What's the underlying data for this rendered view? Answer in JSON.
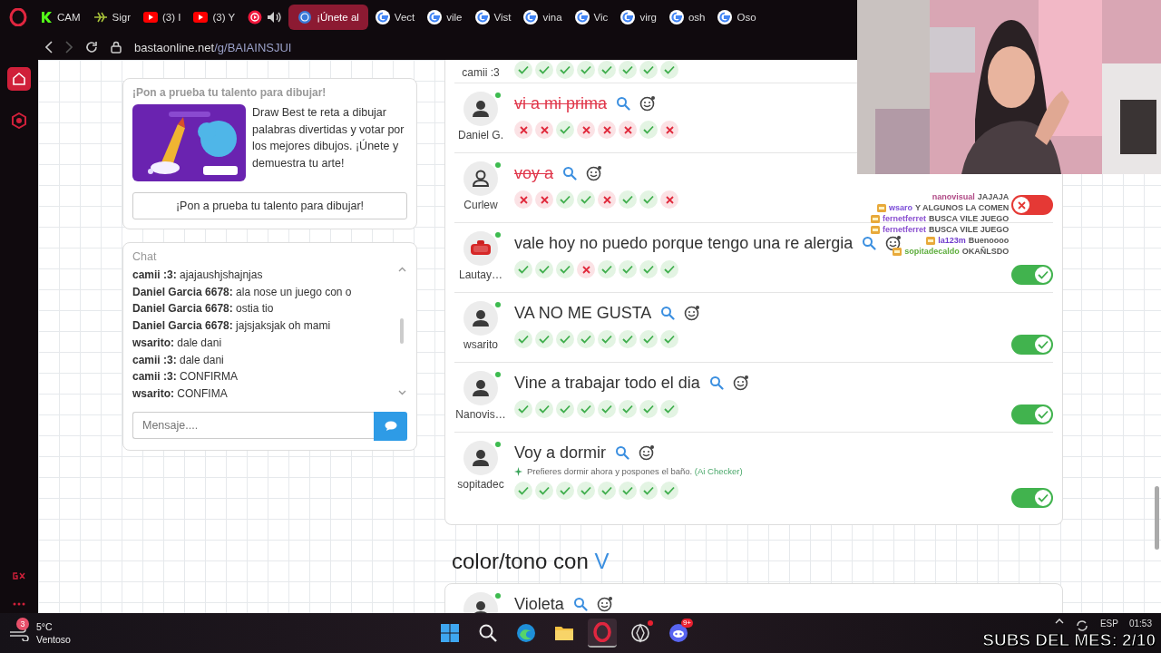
{
  "browser": {
    "tabs": [
      {
        "kind": "k",
        "label": "CAM",
        "selected": false,
        "audio": false
      },
      {
        "kind": "leaf",
        "label": "Sigr",
        "selected": false,
        "audio": false
      },
      {
        "kind": "youtube",
        "label": "(3) I",
        "selected": false,
        "audio": false
      },
      {
        "kind": "youtube",
        "label": "(3) Y",
        "selected": false,
        "audio": false
      },
      {
        "kind": "music",
        "selected": false,
        "audio": true
      },
      {
        "kind": "basta",
        "label": "¡Únete al",
        "selected": true,
        "audio": false
      },
      {
        "kind": "google",
        "label": "Vect",
        "selected": false,
        "audio": false
      },
      {
        "kind": "google",
        "label": "vile",
        "selected": false,
        "audio": false
      },
      {
        "kind": "google",
        "label": "Vist",
        "selected": false,
        "audio": false
      },
      {
        "kind": "google",
        "label": "vina",
        "selected": false,
        "audio": false
      },
      {
        "kind": "google",
        "label": "Vic",
        "selected": false,
        "audio": false
      },
      {
        "kind": "google",
        "label": "virg",
        "selected": false,
        "audio": false
      },
      {
        "kind": "google",
        "label": "osh",
        "selected": false,
        "audio": false
      },
      {
        "kind": "google",
        "label": "Oso",
        "selected": false,
        "audio": false
      }
    ],
    "url_host": "bastaonline.net",
    "url_path": "/g/BAIAINSJUI"
  },
  "promo": {
    "heading": "¡Pon a prueba tu talento para dibujar!",
    "description": "Draw Best te reta a dibujar palabras divertidas y votar por los mejores dibujos. ¡Únete y demuestra tu arte!",
    "button": "¡Pon a prueba tu talento para dibujar!"
  },
  "chat": {
    "title": "Chat",
    "placeholder": "Mensaje....",
    "messages": [
      {
        "user": "camii :3:",
        "text": "ajajaushjshajnjas"
      },
      {
        "user": "Daniel Garcia 6678:",
        "text": "ala nose un juego con o"
      },
      {
        "user": "Daniel Garcia 6678:",
        "text": "ostia tio"
      },
      {
        "user": "Daniel Garcia 6678:",
        "text": "jajsjaksjak oh mami"
      },
      {
        "user": "wsarito:",
        "text": "dale dani"
      },
      {
        "user": "camii :3:",
        "text": "dale dani"
      },
      {
        "user": "camii :3:",
        "text": "CONFIRMA"
      },
      {
        "user": "wsarito:",
        "text": "CONFIMA"
      }
    ]
  },
  "answers": [
    {
      "user": "camii :3",
      "votes": [
        true,
        true,
        true,
        true,
        true,
        true,
        true,
        true
      ]
    },
    {
      "user": "Daniel G.",
      "kind": "person",
      "online": true,
      "answer": "vi a mi prima",
      "rejected": true,
      "votes": [
        false,
        false,
        true,
        false,
        false,
        false,
        true,
        false
      ]
    },
    {
      "user": "Curlew",
      "kind": "person-outline",
      "online": true,
      "answer": "voy a",
      "rejected": true,
      "votes": [
        false,
        false,
        true,
        true,
        false,
        true,
        true,
        false
      ],
      "valid": false
    },
    {
      "user": "Lautay…",
      "kind": "stop",
      "online": true,
      "answer": "vale hoy no puedo porque tengo una re alergia",
      "rejected": false,
      "votes": [
        true,
        true,
        true,
        false,
        true,
        true,
        true,
        true
      ],
      "valid": true
    },
    {
      "user": "wsarito",
      "kind": "person",
      "online": true,
      "answer": "VA NO ME GUSTA",
      "rejected": false,
      "votes": [
        true,
        true,
        true,
        true,
        true,
        true,
        true,
        true
      ],
      "valid": true
    },
    {
      "user": "Nanovis…",
      "kind": "person",
      "online": true,
      "answer": "Vine a trabajar todo el dia",
      "rejected": false,
      "votes": [
        true,
        true,
        true,
        true,
        true,
        true,
        true,
        true
      ],
      "valid": true
    },
    {
      "user": "sopitadec",
      "kind": "person",
      "online": true,
      "answer": "Voy a dormir",
      "rejected": false,
      "hint": "Prefieres dormir ahora y pospones el baño.",
      "hint_source": "(Ai Checker)",
      "votes": [
        true,
        true,
        true,
        true,
        true,
        true,
        true,
        true
      ],
      "valid": true
    }
  ],
  "next_category": {
    "prefix": "color/tono con",
    "letter": "V",
    "answers": [
      {
        "answer": "Violeta",
        "kind": "person",
        "online": true
      }
    ]
  },
  "stream": {
    "subs": "SUBS DEL MES: 2/10",
    "chat": [
      {
        "user": "nanovisual",
        "text": "JAJAJA",
        "color": "#b04a86",
        "badge": false
      },
      {
        "user": "wsaro",
        "text": "Y ALGUNOS LA COMEN",
        "color": "#7a4cd8",
        "badge": true
      },
      {
        "user": "fernetferret",
        "text": "BUSCA VILE JUEGO",
        "color": "#8a50d0",
        "badge": true
      },
      {
        "user": "fernetferret",
        "text": "BUSCA VILE JUEGO",
        "color": "#8a50d0",
        "badge": true
      },
      {
        "user": "la123m",
        "text": "Buenoooo",
        "color": "#6f3ccc",
        "badge": true
      },
      {
        "user": "sopitadecaldo",
        "text": "OKAÑLSDO",
        "color": "#5fae3e",
        "badge": true
      }
    ]
  },
  "taskbar": {
    "weather": {
      "temp": "5°C",
      "condition": "Ventoso",
      "badge": "3"
    },
    "apps": [
      {
        "kind": "windows",
        "active": false
      },
      {
        "kind": "search",
        "active": false
      },
      {
        "kind": "edge",
        "active": false
      },
      {
        "kind": "folder",
        "active": false
      },
      {
        "kind": "opera",
        "active": true
      },
      {
        "kind": "app",
        "active": false,
        "dot": true
      },
      {
        "kind": "discord",
        "active": false,
        "badge": "9+"
      }
    ],
    "language": "ESP",
    "time": "01:53"
  }
}
